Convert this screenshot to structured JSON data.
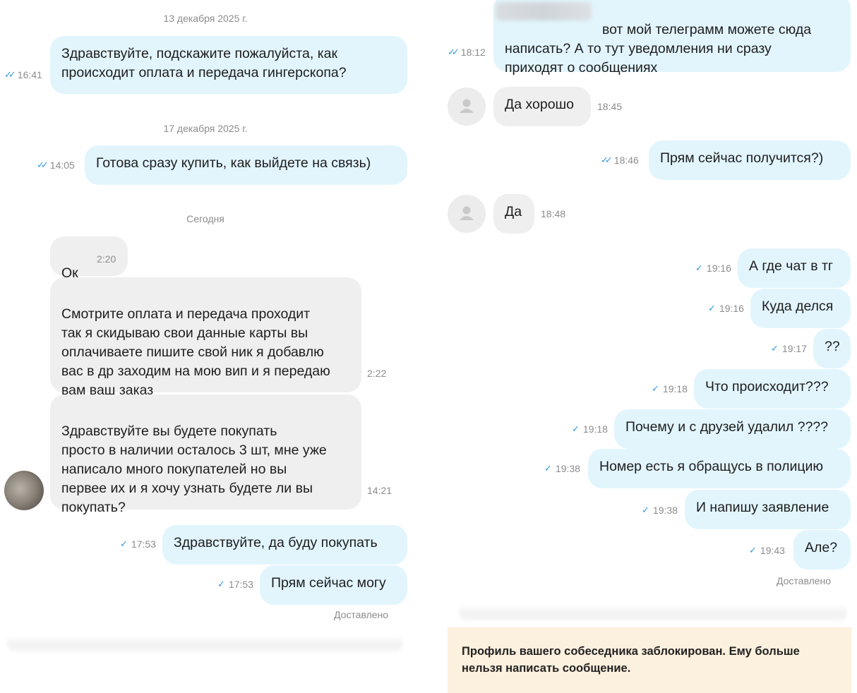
{
  "left": {
    "date_1": "13 декабря 2025 г.",
    "date_2": "17 декабря 2025 г.",
    "date_3": "Сегодня",
    "msgs": [
      {
        "text": "Здравствуйте, подскажите пожалуйста, как\nпроисходит оплата и передача гингерскопа?",
        "time": "16:41"
      },
      {
        "text": "Готова сразу купить, как выйдете на связь)",
        "time": "14:05"
      },
      {
        "text": "Ок",
        "time": "2:20"
      },
      {
        "text": "Смотрите оплата и передача проходит\nтак я скидываю свои данные карты вы\nоплачиваете пишите свой ник я добавлю\nвас в др заходим на мою вип и я передаю\nвам ваш заказ",
        "time": "2:22"
      },
      {
        "text": "Здравствуйте вы будете покупать\nпросто в наличии осталось 3 шт, мне уже\nнаписало много покупателей но вы\nпервее их и я хочу узнать будете ли вы\nпокупать?",
        "time": "14:21"
      },
      {
        "text": "Здравствуйте, да буду покупать",
        "time": "17:53"
      },
      {
        "text": "Прям сейчас могу",
        "time": "17:53"
      }
    ],
    "status": "Доставлено"
  },
  "right": {
    "msgs": [
      {
        "text": "вот мой телеграмм можете сюда\nнаписать? А то тут уведомления ни сразу\nприходят о сообщениях",
        "time": "18:12"
      },
      {
        "text": "Да хорошо",
        "time": "18:45"
      },
      {
        "text": "Прям сейчас получится?)",
        "time": "18:46"
      },
      {
        "text": "Да",
        "time": "18:48"
      },
      {
        "text": "А где чат в тг",
        "time": "19:16"
      },
      {
        "text": "Куда делся",
        "time": "19:16"
      },
      {
        "text": "??",
        "time": "19:17"
      },
      {
        "text": "Что происходит???",
        "time": "19:18"
      },
      {
        "text": "Почему и с друзей удалил ????",
        "time": "19:18"
      },
      {
        "text": "Номер есть я обращусь в полицию",
        "time": "19:38"
      },
      {
        "text": "И напишу заявление",
        "time": "19:38"
      },
      {
        "text": "Але?",
        "time": "19:43"
      }
    ],
    "status": "Доставлено",
    "notice": "Профиль вашего собеседника заблокирован. Ему больше\nнельзя написать сообщение."
  },
  "icons": {
    "read": "double-check-icon",
    "sent": "single-check-icon",
    "avatar": "user-placeholder-icon"
  },
  "colors": {
    "outgoing_bubble": "#e2f5fd",
    "incoming_bubble": "#efefef",
    "check": "#2f9be0",
    "notice_bg": "#fcf0de"
  }
}
